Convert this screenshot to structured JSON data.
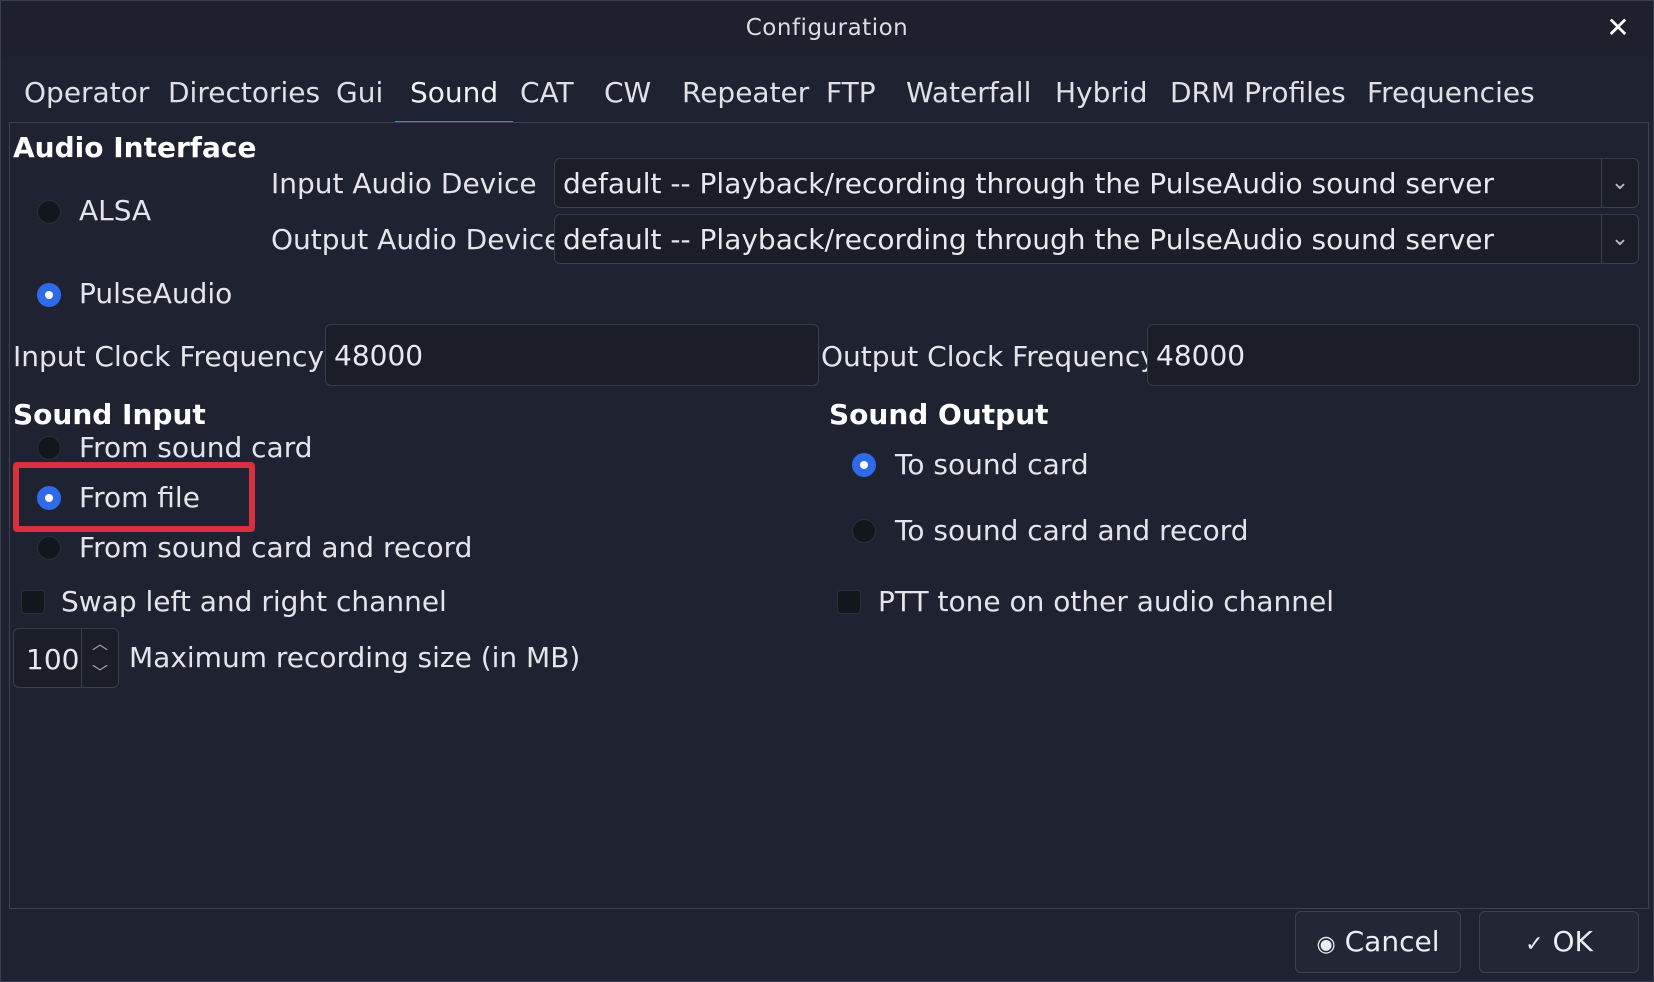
{
  "window": {
    "title": "Configuration",
    "close_glyph": "✕"
  },
  "tabs": [
    {
      "label": "Operator"
    },
    {
      "label": "Directories"
    },
    {
      "label": "Gui"
    },
    {
      "label": "Sound",
      "active": true
    },
    {
      "label": "CAT"
    },
    {
      "label": "CW"
    },
    {
      "label": "Repeater"
    },
    {
      "label": "FTP"
    },
    {
      "label": "Waterfall"
    },
    {
      "label": "Hybrid"
    },
    {
      "label": "DRM Profiles"
    },
    {
      "label": "Frequencies"
    }
  ],
  "audio_interface": {
    "heading": "Audio Interface",
    "options": [
      {
        "label": "ALSA",
        "selected": false
      },
      {
        "label": "PulseAudio",
        "selected": true
      }
    ],
    "input_device_label": "Input Audio Device",
    "input_device_value": "default -- Playback/recording through the PulseAudio sound server",
    "output_device_label": "Output Audio Device",
    "output_device_value": "default -- Playback/recording through the PulseAudio sound server"
  },
  "clock": {
    "input_label": "Input  Clock Frequency",
    "input_value": "48000",
    "output_label": "Output Clock Frequency",
    "output_value": "48000"
  },
  "sound_input": {
    "heading": "Sound Input",
    "options": [
      {
        "label": "From sound card",
        "selected": false
      },
      {
        "label": "From file",
        "selected": true
      },
      {
        "label": "From sound card and record",
        "selected": false
      }
    ]
  },
  "sound_output": {
    "heading": "Sound Output",
    "options": [
      {
        "label": "To sound card",
        "selected": true
      },
      {
        "label": "To sound card and record",
        "selected": false
      }
    ]
  },
  "swap_channel": {
    "label": "Swap left and right channel",
    "checked": false
  },
  "ptt_tone": {
    "label": "PTT tone on other audio channel",
    "checked": false
  },
  "recording": {
    "value": "100",
    "label": "Maximum recording size (in MB)"
  },
  "buttons": {
    "cancel_label": "Cancel",
    "ok_label": "OK"
  },
  "colors": {
    "accent": "#3d7bf0",
    "highlight": "#d9303f",
    "background": "#1f2230"
  },
  "icons": {
    "chevron": "chevron-down-icon",
    "cancel": "cancel-icon",
    "ok": "check-icon"
  }
}
